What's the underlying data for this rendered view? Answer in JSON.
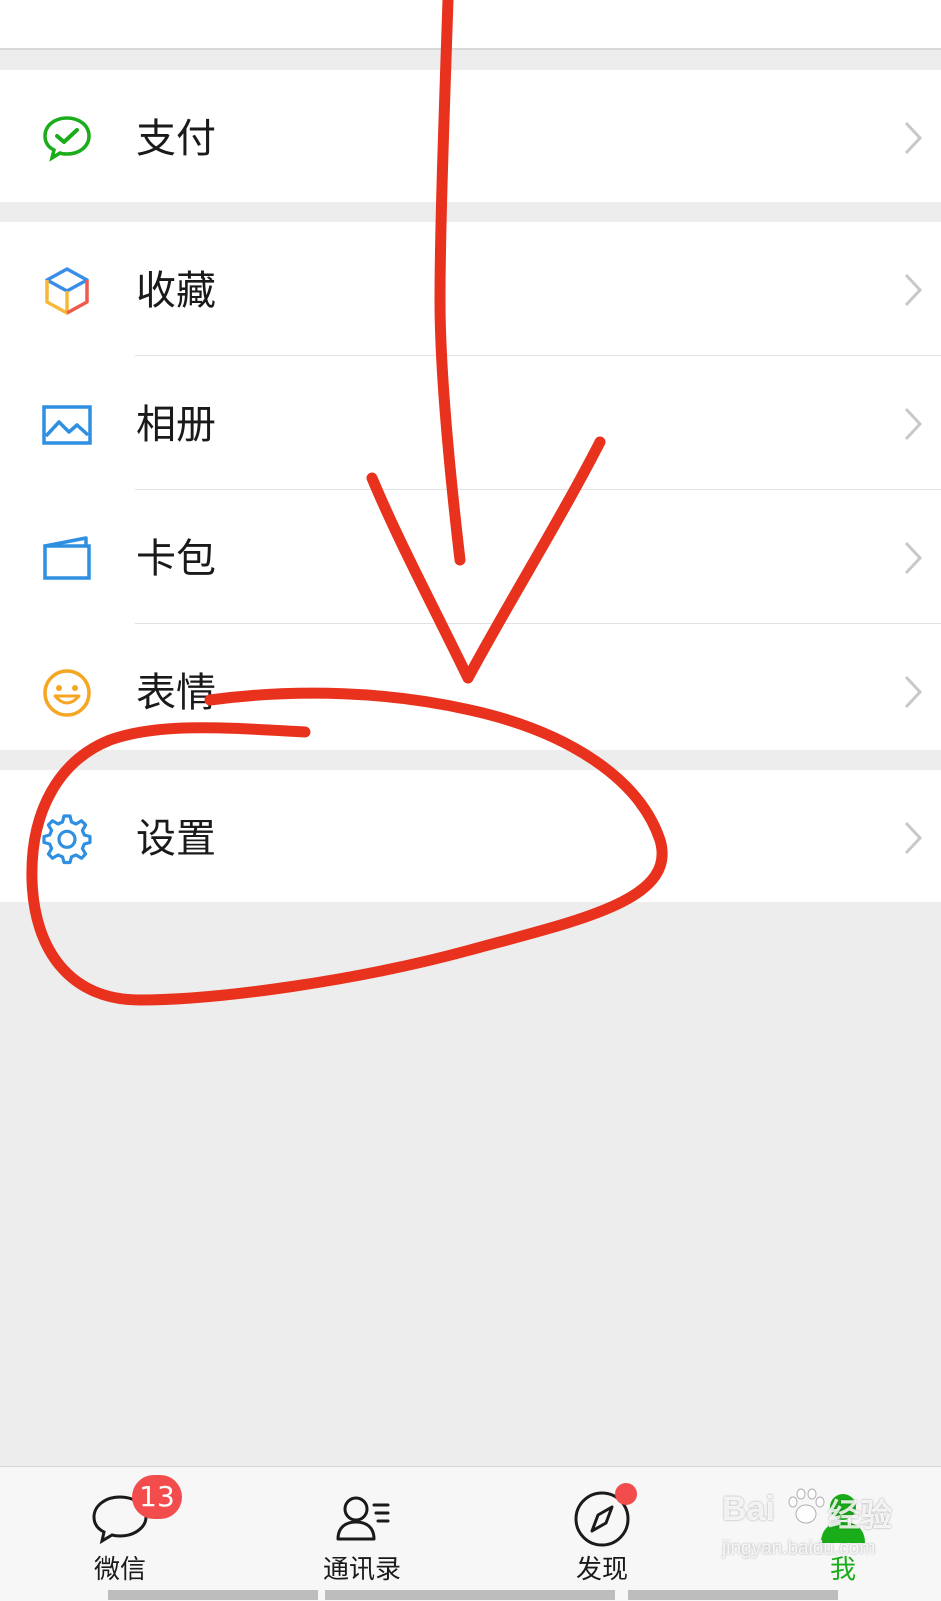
{
  "menu": {
    "pay": {
      "label": "支付",
      "icon": "wechat-pay-icon"
    },
    "favorites": {
      "label": "收藏",
      "icon": "cube-icon"
    },
    "album": {
      "label": "相册",
      "icon": "picture-icon"
    },
    "cards": {
      "label": "卡包",
      "icon": "card-wallet-icon"
    },
    "stickers": {
      "label": "表情",
      "icon": "smiley-icon"
    },
    "settings": {
      "label": "设置",
      "icon": "gear-icon"
    }
  },
  "tabbar": {
    "chats": {
      "label": "微信",
      "badge": "13",
      "icon": "chat-bubble-icon"
    },
    "contacts": {
      "label": "通讯录",
      "icon": "contacts-icon"
    },
    "discover": {
      "label": "发现",
      "icon": "compass-icon",
      "has_dot": true
    },
    "me": {
      "label": "我",
      "icon": "person-icon",
      "active": true
    }
  },
  "watermark": {
    "brand": "Bai",
    "brand_suffix": "经验",
    "url": "jingyan.baidu.com"
  },
  "colors": {
    "accent_green": "#1aad19",
    "badge_red": "#f24c4c",
    "annotation_red": "#e8321e",
    "background": "#ededed"
  }
}
